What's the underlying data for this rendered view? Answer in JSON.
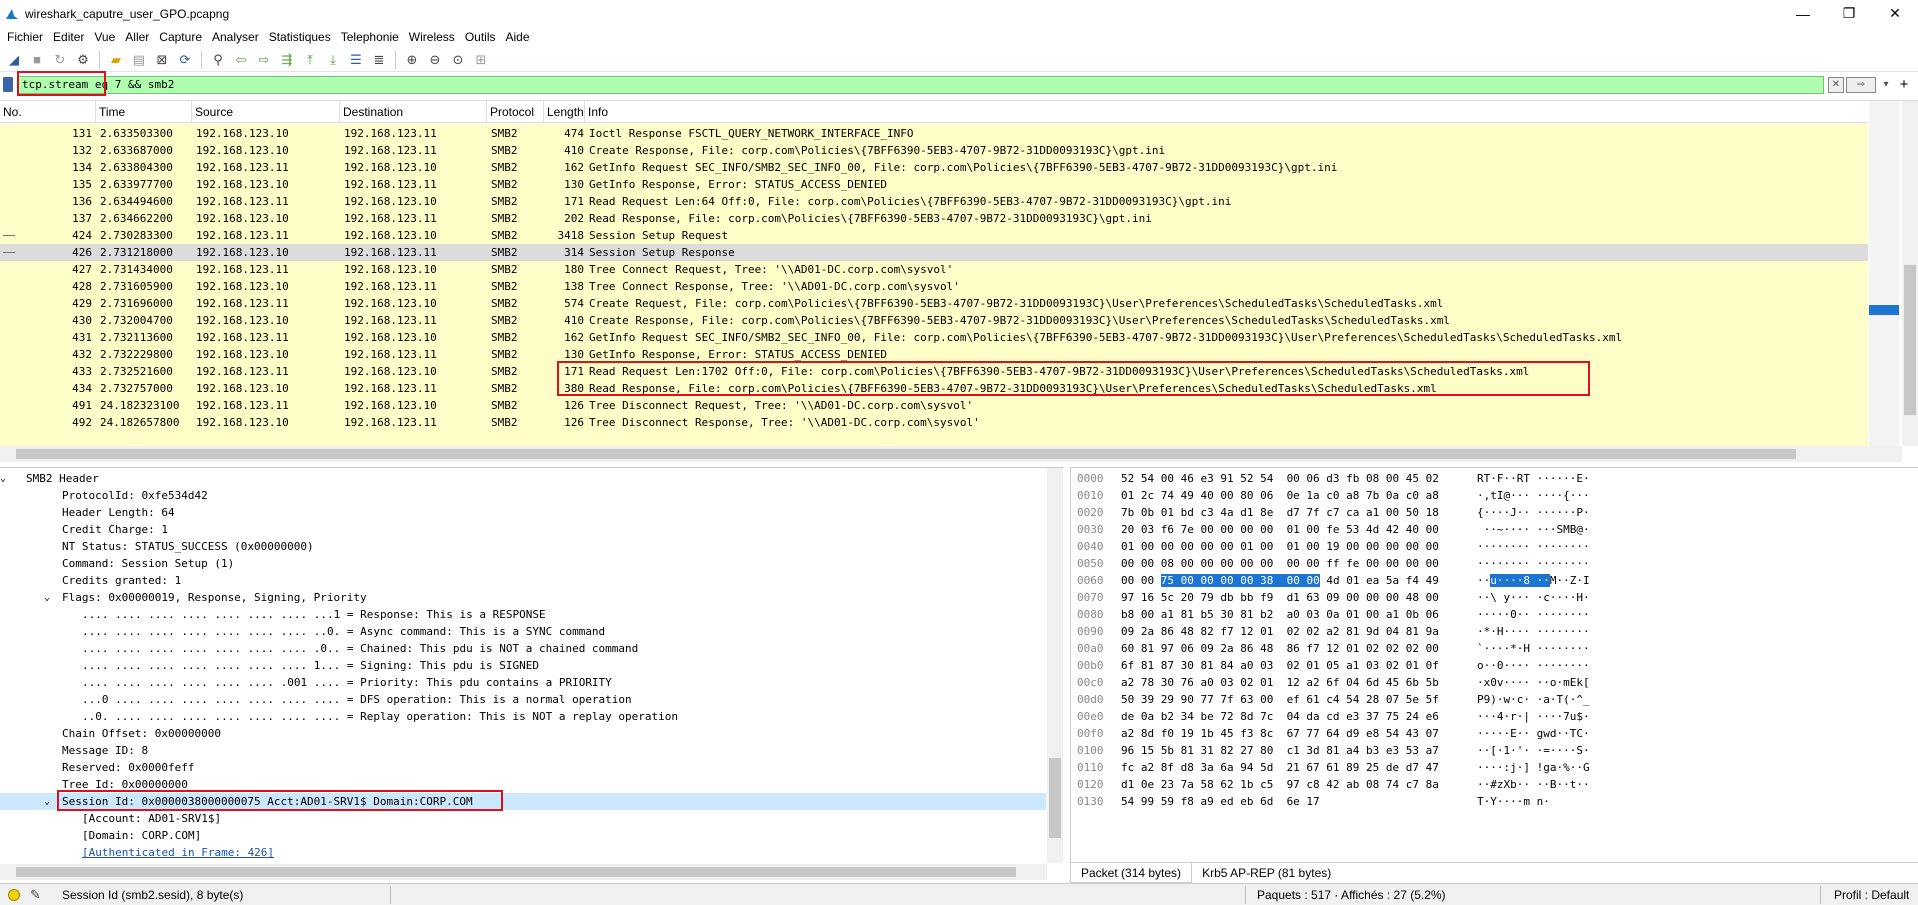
{
  "window": {
    "title": "wireshark_caputre_user_GPO.pcapng"
  },
  "window_controls": {
    "minimize": "—",
    "maximize": "❐",
    "close": "✕"
  },
  "menu": [
    "Fichier",
    "Editer",
    "Vue",
    "Aller",
    "Capture",
    "Analyser",
    "Statistiques",
    "Telephonie",
    "Wireless",
    "Outils",
    "Aide"
  ],
  "filter": {
    "value": "tcp.stream eq 7 && smb2"
  },
  "packet_list": {
    "columns": [
      "No.",
      "Time",
      "Source",
      "Destination",
      "Protocol",
      "Length",
      "Info"
    ],
    "rows": [
      {
        "no": "131",
        "time": "2.633503300",
        "src": "192.168.123.10",
        "dst": "192.168.123.11",
        "proto": "SMB2",
        "len": "474",
        "info": "Ioctl Response FSCTL_QUERY_NETWORK_INTERFACE_INFO"
      },
      {
        "no": "132",
        "time": "2.633687000",
        "src": "192.168.123.10",
        "dst": "192.168.123.11",
        "proto": "SMB2",
        "len": "410",
        "info": "Create Response, File: corp.com\\Policies\\{7BFF6390-5EB3-4707-9B72-31DD0093193C}\\gpt.ini"
      },
      {
        "no": "134",
        "time": "2.633804300",
        "src": "192.168.123.11",
        "dst": "192.168.123.10",
        "proto": "SMB2",
        "len": "162",
        "info": "GetInfo Request SEC_INFO/SMB2_SEC_INFO_00, File: corp.com\\Policies\\{7BFF6390-5EB3-4707-9B72-31DD0093193C}\\gpt.ini"
      },
      {
        "no": "135",
        "time": "2.633977700",
        "src": "192.168.123.10",
        "dst": "192.168.123.11",
        "proto": "SMB2",
        "len": "130",
        "info": "GetInfo Response, Error: STATUS_ACCESS_DENIED"
      },
      {
        "no": "136",
        "time": "2.634494600",
        "src": "192.168.123.11",
        "dst": "192.168.123.10",
        "proto": "SMB2",
        "len": "171",
        "info": "Read Request Len:64 Off:0, File: corp.com\\Policies\\{7BFF6390-5EB3-4707-9B72-31DD0093193C}\\gpt.ini"
      },
      {
        "no": "137",
        "time": "2.634662200",
        "src": "192.168.123.10",
        "dst": "192.168.123.11",
        "proto": "SMB2",
        "len": "202",
        "info": "Read Response, File: corp.com\\Policies\\{7BFF6390-5EB3-4707-9B72-31DD0093193C}\\gpt.ini"
      },
      {
        "no": "424",
        "time": "2.730283300",
        "src": "192.168.123.11",
        "dst": "192.168.123.10",
        "proto": "SMB2",
        "len": "3418",
        "info": "Session Setup Request"
      },
      {
        "no": "426",
        "time": "2.731218000",
        "src": "192.168.123.10",
        "dst": "192.168.123.11",
        "proto": "SMB2",
        "len": "314",
        "info": "Session Setup Response"
      },
      {
        "no": "427",
        "time": "2.731434000",
        "src": "192.168.123.11",
        "dst": "192.168.123.10",
        "proto": "SMB2",
        "len": "180",
        "info": "Tree Connect Request, Tree: '\\\\AD01-DC.corp.com\\sysvol'"
      },
      {
        "no": "428",
        "time": "2.731605900",
        "src": "192.168.123.10",
        "dst": "192.168.123.11",
        "proto": "SMB2",
        "len": "138",
        "info": "Tree Connect Response, Tree: '\\\\AD01-DC.corp.com\\sysvol'"
      },
      {
        "no": "429",
        "time": "2.731696000",
        "src": "192.168.123.11",
        "dst": "192.168.123.10",
        "proto": "SMB2",
        "len": "574",
        "info": "Create Request, File: corp.com\\Policies\\{7BFF6390-5EB3-4707-9B72-31DD0093193C}\\User\\Preferences\\ScheduledTasks\\ScheduledTasks.xml"
      },
      {
        "no": "430",
        "time": "2.732004700",
        "src": "192.168.123.10",
        "dst": "192.168.123.11",
        "proto": "SMB2",
        "len": "410",
        "info": "Create Response, File: corp.com\\Policies\\{7BFF6390-5EB3-4707-9B72-31DD0093193C}\\User\\Preferences\\ScheduledTasks\\ScheduledTasks.xml"
      },
      {
        "no": "431",
        "time": "2.732113600",
        "src": "192.168.123.11",
        "dst": "192.168.123.10",
        "proto": "SMB2",
        "len": "162",
        "info": "GetInfo Request SEC_INFO/SMB2_SEC_INFO_00, File: corp.com\\Policies\\{7BFF6390-5EB3-4707-9B72-31DD0093193C}\\User\\Preferences\\ScheduledTasks\\ScheduledTasks.xml"
      },
      {
        "no": "432",
        "time": "2.732229800",
        "src": "192.168.123.10",
        "dst": "192.168.123.11",
        "proto": "SMB2",
        "len": "130",
        "info": "GetInfo Response, Error: STATUS_ACCESS_DENIED"
      },
      {
        "no": "433",
        "time": "2.732521600",
        "src": "192.168.123.11",
        "dst": "192.168.123.10",
        "proto": "SMB2",
        "len": "171",
        "info": "Read Request Len:1702 Off:0, File: corp.com\\Policies\\{7BFF6390-5EB3-4707-9B72-31DD0093193C}\\User\\Preferences\\ScheduledTasks\\ScheduledTasks.xml"
      },
      {
        "no": "434",
        "time": "2.732757000",
        "src": "192.168.123.10",
        "dst": "192.168.123.11",
        "proto": "SMB2",
        "len": "380",
        "info": "Read Response, File: corp.com\\Policies\\{7BFF6390-5EB3-4707-9B72-31DD0093193C}\\User\\Preferences\\ScheduledTasks\\ScheduledTasks.xml"
      },
      {
        "no": "491",
        "time": "24.182323100",
        "src": "192.168.123.11",
        "dst": "192.168.123.10",
        "proto": "SMB2",
        "len": "126",
        "info": "Tree Disconnect Request, Tree: '\\\\AD01-DC.corp.com\\sysvol'"
      },
      {
        "no": "492",
        "time": "24.182657800",
        "src": "192.168.123.10",
        "dst": "192.168.123.11",
        "proto": "SMB2",
        "len": "126",
        "info": "Tree Disconnect Response, Tree: '\\\\AD01-DC.corp.com\\sysvol'"
      }
    ]
  },
  "details": {
    "smb2_header": "SMB2 Header",
    "protocol_id": "ProtocolId: 0xfe534d42",
    "header_length": "Header Length: 64",
    "credit_charge": "Credit Charge: 1",
    "nt_status": "NT Status: STATUS_SUCCESS (0x00000000)",
    "command": "Command: Session Setup (1)",
    "credits_granted": "Credits granted: 1",
    "flags": "Flags: 0x00000019, Response, Signing, Priority",
    "flag_lines": [
      ".... .... .... .... .... .... .... ...1 = Response: This is a RESPONSE",
      ".... .... .... .... .... .... .... ..0. = Async command: This is a SYNC command",
      ".... .... .... .... .... .... .... .0.. = Chained: This pdu is NOT a chained command",
      ".... .... .... .... .... .... .... 1... = Signing: This pdu is SIGNED",
      ".... .... .... .... .... .... .001 .... = Priority: This pdu contains a PRIORITY",
      "...0 .... .... .... .... .... .... .... = DFS operation: This is a normal operation",
      "..0. .... .... .... .... .... .... .... = Replay operation: This is NOT a replay operation"
    ],
    "chain_offset": "Chain Offset: 0x00000000",
    "message_id": "Message ID: 8",
    "reserved": "Reserved: 0x0000feff",
    "tree_id": "Tree Id: 0x00000000",
    "session_id": "Session Id: 0x0000038000000075 Acct:AD01-SRV1$ Domain:CORP.COM",
    "account": "[Account: AD01-SRV1$]",
    "domain": "[Domain: CORP.COM]",
    "auth_frame": "[Authenticated in Frame: 426]"
  },
  "bytes": {
    "rows": [
      {
        "off": "0000",
        "hex": "52 54 00 46 e3 91 52 54  00 06 d3 fb 08 00 45 02",
        "ascii": "RT·F··RT ······E·"
      },
      {
        "off": "0010",
        "hex": "01 2c 74 49 40 00 80 06  0e 1a c0 a8 7b 0a c0 a8",
        "ascii": "·,tI@··· ····{···"
      },
      {
        "off": "0020",
        "hex": "7b 0b 01 bd c3 4a d1 8e  d7 7f c7 ca a1 00 50 18",
        "ascii": "{····J·· ······P·"
      },
      {
        "off": "0030",
        "hex": "20 03 f6 7e 00 00 00 00  01 00 fe 53 4d 42 40 00",
        "ascii": " ··~···· ···SMB@·"
      },
      {
        "off": "0040",
        "hex": "01 00 00 00 00 00 01 00  01 00 19 00 00 00 00 00",
        "ascii": "········ ········"
      },
      {
        "off": "0050",
        "hex": "00 00 08 00 00 00 00 00  00 00 ff fe 00 00 00 00",
        "ascii": "········ ········"
      },
      {
        "off": "0060",
        "hex_pre": "00 00 ",
        "hex_sel": "75 00 00 00 00 38  00 00",
        "hex_post": " 4d 01 ea 5a f4 49",
        "ascii_pre": "··",
        "ascii_sel": "u····8 ··",
        "ascii_post": "M··Z·I"
      },
      {
        "off": "0070",
        "hex": "97 16 5c 20 79 db bb f9  d1 63 09 00 00 00 48 00",
        "ascii": "··\\ y··· ·c····H·"
      },
      {
        "off": "0080",
        "hex": "b8 00 a1 81 b5 30 81 b2  a0 03 0a 01 00 a1 0b 06",
        "ascii": "·····0·· ········"
      },
      {
        "off": "0090",
        "hex": "09 2a 86 48 82 f7 12 01  02 02 a2 81 9d 04 81 9a",
        "ascii": "·*·H···· ········"
      },
      {
        "off": "00a0",
        "hex": "60 81 97 06 09 2a 86 48  86 f7 12 01 02 02 02 00",
        "ascii": "`····*·H ········"
      },
      {
        "off": "00b0",
        "hex": "6f 81 87 30 81 84 a0 03  02 01 05 a1 03 02 01 0f",
        "ascii": "o··0···· ········"
      },
      {
        "off": "00c0",
        "hex": "a2 78 30 76 a0 03 02 01  12 a2 6f 04 6d 45 6b 5b",
        "ascii": "·x0v···· ··o·mEk["
      },
      {
        "off": "00d0",
        "hex": "50 39 29 90 77 7f 63 00  ef 61 c4 54 28 07 5e 5f",
        "ascii": "P9)·w·c· ·a·T(·^_"
      },
      {
        "off": "00e0",
        "hex": "de 0a b2 34 be 72 8d 7c  04 da cd e3 37 75 24 e6",
        "ascii": "···4·r·| ····7u$·"
      },
      {
        "off": "00f0",
        "hex": "a2 8d f0 19 1b 45 f3 8c  67 77 64 d9 e8 54 43 07",
        "ascii": "·····E·· gwd··TC·"
      },
      {
        "off": "0100",
        "hex": "96 15 5b 81 31 82 27 80  c1 3d 81 a4 b3 e3 53 a7",
        "ascii": "··[·1·'· ·=····S·"
      },
      {
        "off": "0110",
        "hex": "fc a2 8f d8 3a 6a 94 5d  21 67 61 89 25 de d7 47",
        "ascii": "····:j·] !ga·%··G"
      },
      {
        "off": "0120",
        "hex": "d1 0e 23 7a 58 62 1b c5  97 c8 42 ab 08 74 c7 8a",
        "ascii": "··#zXb·· ··B··t··"
      },
      {
        "off": "0130",
        "hex": "54 99 59 f8 a9 ed eb 6d  6e 17",
        "ascii": "T·Y····m n·"
      }
    ],
    "tabs": [
      "Packet (314 bytes)",
      "Krb5 AP-REP (81 bytes)"
    ]
  },
  "status": {
    "field": "Session Id (smb2.sesid), 8 byte(s)",
    "packets": "Paquets : 517 · Affichés : 27 (5.2%)",
    "profile": "Profil : Default"
  }
}
